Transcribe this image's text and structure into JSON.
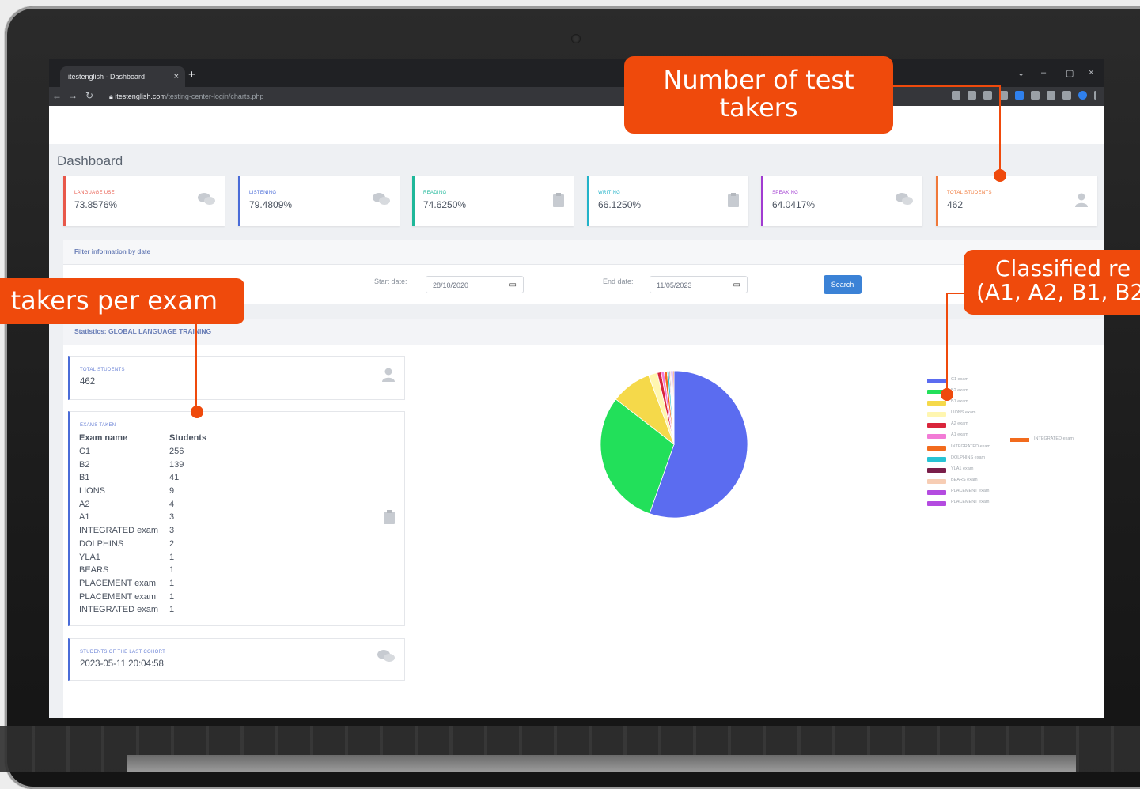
{
  "browser": {
    "tab_title": "itestenglish - Dashboard",
    "tab_close": "×",
    "new_tab": "+",
    "url_domain": "itestenglish.com",
    "url_path": "/testing-center-login/charts.php",
    "window_controls": [
      "⌄",
      "–",
      "▢",
      "×"
    ]
  },
  "page": {
    "title": "Dashboard"
  },
  "stat_cards": [
    {
      "label": "LANGUAGE USE",
      "value": "73.8576%",
      "color": "#e8584a",
      "icon": "chat-icon"
    },
    {
      "label": "LISTENING",
      "value": "79.4809%",
      "color": "#4a6cd8",
      "icon": "chat-icon"
    },
    {
      "label": "READING",
      "value": "74.6250%",
      "color": "#1fb89a",
      "icon": "clipboard-icon"
    },
    {
      "label": "WRITING",
      "value": "66.1250%",
      "color": "#22b3c9",
      "icon": "clipboard-icon"
    },
    {
      "label": "SPEAKING",
      "value": "64.0417%",
      "color": "#a13bd1",
      "icon": "chat-icon"
    },
    {
      "label": "TOTAL STUDENTS",
      "value": "462",
      "color": "#f0793a",
      "icon": "user-icon"
    }
  ],
  "filter": {
    "title": "Filter information by date",
    "start_label": "Start date:",
    "start_value": "28/10/2020",
    "end_label": "End date:",
    "end_value": "11/05/2023",
    "search_label": "Search"
  },
  "statistics": {
    "title": "Statistics: GLOBAL LANGUAGE TRAINING",
    "total_label": "TOTAL STUDENTS",
    "total_value": "462",
    "exams_label": "EXAMS TAKEN",
    "col_exam": "Exam name",
    "col_students": "Students",
    "exams": [
      {
        "name": "C1",
        "students": "256"
      },
      {
        "name": "B2",
        "students": "139"
      },
      {
        "name": "B1",
        "students": "41"
      },
      {
        "name": "LIONS",
        "students": "9"
      },
      {
        "name": "A2",
        "students": "4"
      },
      {
        "name": "A1",
        "students": "3"
      },
      {
        "name": "INTEGRATED exam",
        "students": "3"
      },
      {
        "name": "DOLPHINS",
        "students": "2"
      },
      {
        "name": "YLA1",
        "students": "1"
      },
      {
        "name": "BEARS",
        "students": "1"
      },
      {
        "name": "PLACEMENT exam",
        "students": "1"
      },
      {
        "name": "PLACEMENT exam",
        "students": "1"
      },
      {
        "name": "INTEGRATED exam",
        "students": "1"
      }
    ],
    "cohort_label": "STUDENTS OF THE LAST COHORT",
    "cohort_value": "2023-05-11 20:04:58"
  },
  "chart_data": {
    "type": "pie",
    "categories": [
      "C1 exam",
      "B2 exam",
      "B1 exam",
      "LIONS exam",
      "A2 exam",
      "A1 exam",
      "INTEGRATED exam",
      "DOLPHINS exam",
      "YLA1 exam",
      "BEARS exam",
      "PLACEMENT exam",
      "PLACEMENT exam",
      "INTEGRATED exam"
    ],
    "values": [
      256,
      139,
      41,
      9,
      4,
      3,
      3,
      2,
      1,
      1,
      1,
      1,
      1
    ],
    "colors": [
      "#5b6cf0",
      "#22e05a",
      "#f5d94a",
      "#fff6b0",
      "#d9253b",
      "#f27bd6",
      "#f26b1d",
      "#27c3d4",
      "#7a1e4a",
      "#f7cdb4",
      "#b44be0",
      "#b44be0",
      "#f26b1d"
    ]
  },
  "callouts": {
    "test_takers": "Number of test takers",
    "per_exam": "takers per exam",
    "classified_line1": "Classified re",
    "classified_line2": "(A1, A2, B1, B2,"
  }
}
